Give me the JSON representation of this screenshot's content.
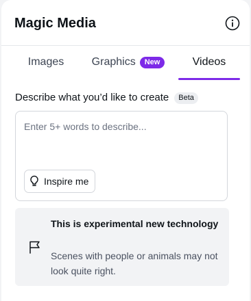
{
  "panel": {
    "title": "Magic Media",
    "info_icon": "info-circle-icon"
  },
  "tabs": [
    {
      "label": "Images",
      "active": false
    },
    {
      "label": "Graphics",
      "badge": "New",
      "active": false
    },
    {
      "label": "Videos",
      "active": true
    }
  ],
  "prompt": {
    "label": "Describe what you’d like to create",
    "badge": "Beta",
    "placeholder": "Enter 5+ words to describe...",
    "value": "",
    "inspire_label": "Inspire me",
    "inspire_icon": "lightbulb-icon"
  },
  "notice": {
    "icon": "flag-icon",
    "title": "This is experimental new technology",
    "body": "Scenes with people or animals may not look quite right."
  },
  "colors": {
    "accent": "#7d2ae8",
    "panel_bg": "#ffffff",
    "page_bg": "#f2f3f5",
    "notice_bg": "#f2f3f5"
  }
}
